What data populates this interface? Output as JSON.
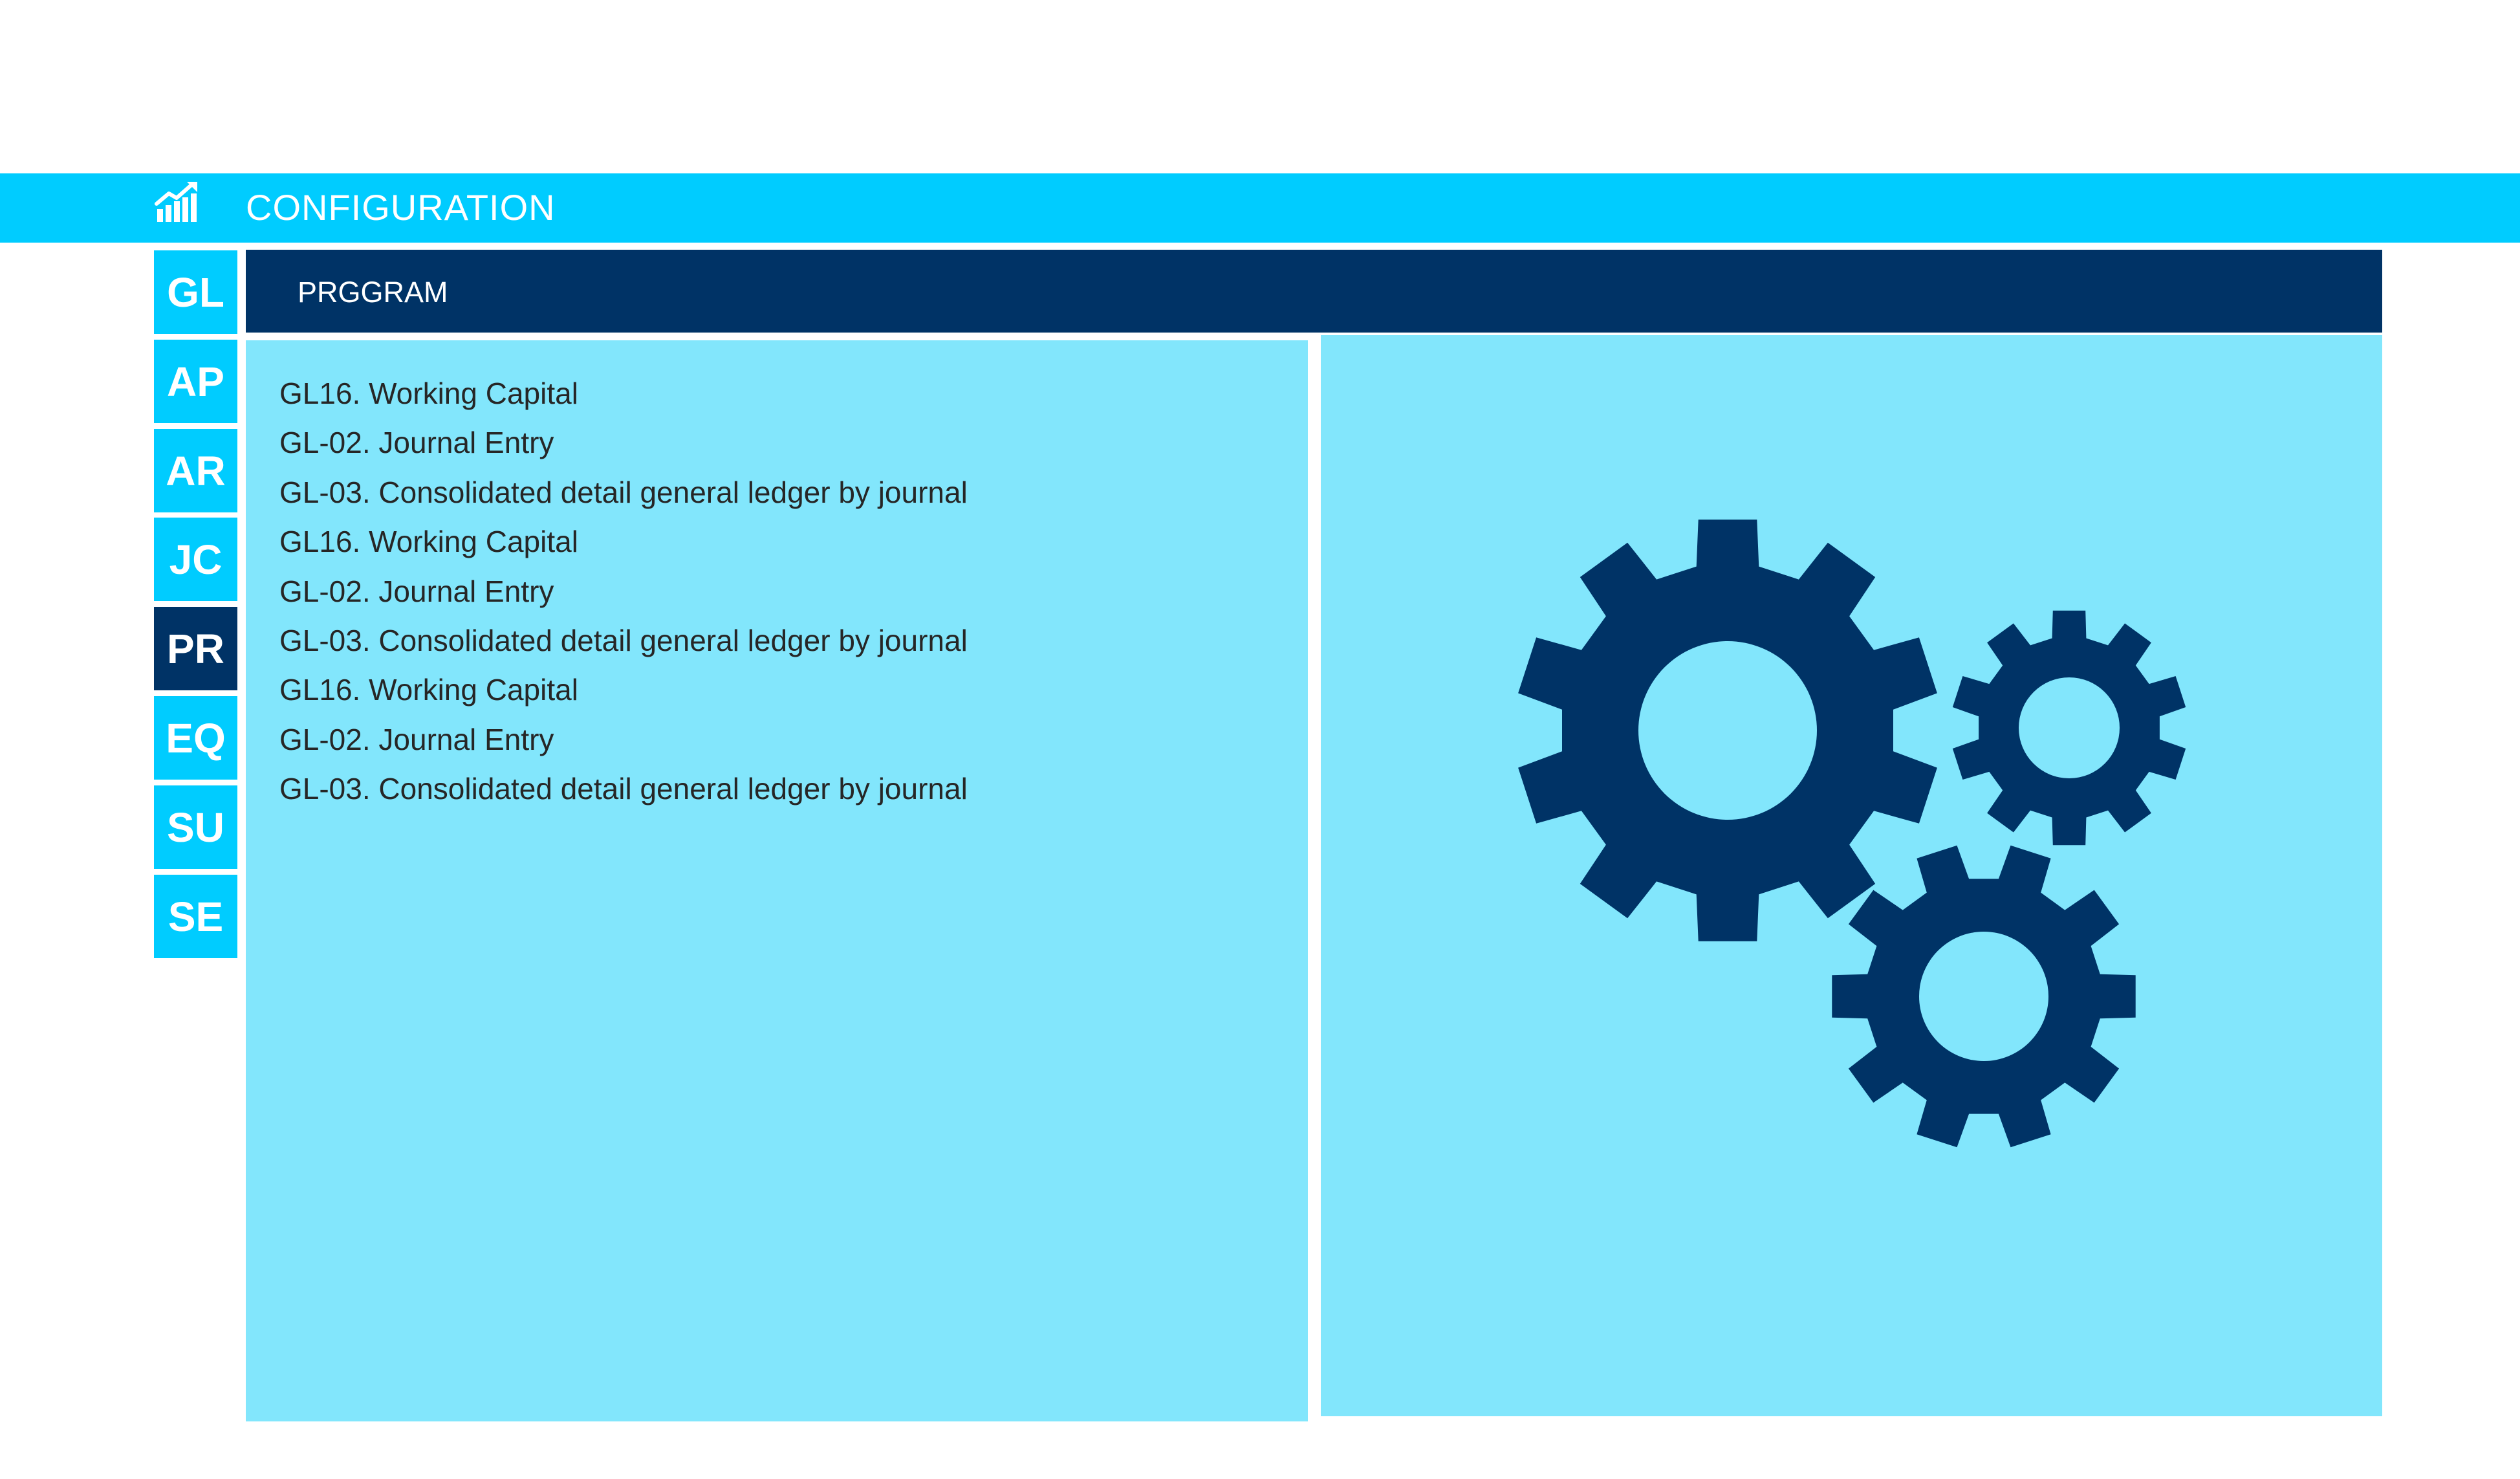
{
  "header": {
    "title": "CONFIGURATION",
    "icon": "growth-chart-icon"
  },
  "nav": {
    "items": [
      {
        "label": "GL",
        "active": false
      },
      {
        "label": "AP",
        "active": false
      },
      {
        "label": "AR",
        "active": false
      },
      {
        "label": "JC",
        "active": false
      },
      {
        "label": "PR",
        "active": true
      },
      {
        "label": "EQ",
        "active": false
      },
      {
        "label": "SU",
        "active": false
      },
      {
        "label": "SE",
        "active": false
      }
    ]
  },
  "program": {
    "title": "PRGGRAM",
    "items": [
      "GL16. Working Capital",
      "GL-02. Journal Entry",
      "GL-03. Consolidated detail general ledger by journal",
      "GL16. Working Capital",
      "GL-02. Journal Entry",
      "GL-03. Consolidated detail general ledger by journal",
      "GL16. Working Capital",
      "GL-02. Journal Entry",
      "GL-03. Consolidated detail general ledger by journal"
    ]
  },
  "illustration": {
    "icon": "gears-icon"
  },
  "colors": {
    "accent_cyan": "#00ccff",
    "navy": "#003366",
    "panel_light": "#82e6fc",
    "text_dark": "#262626"
  }
}
